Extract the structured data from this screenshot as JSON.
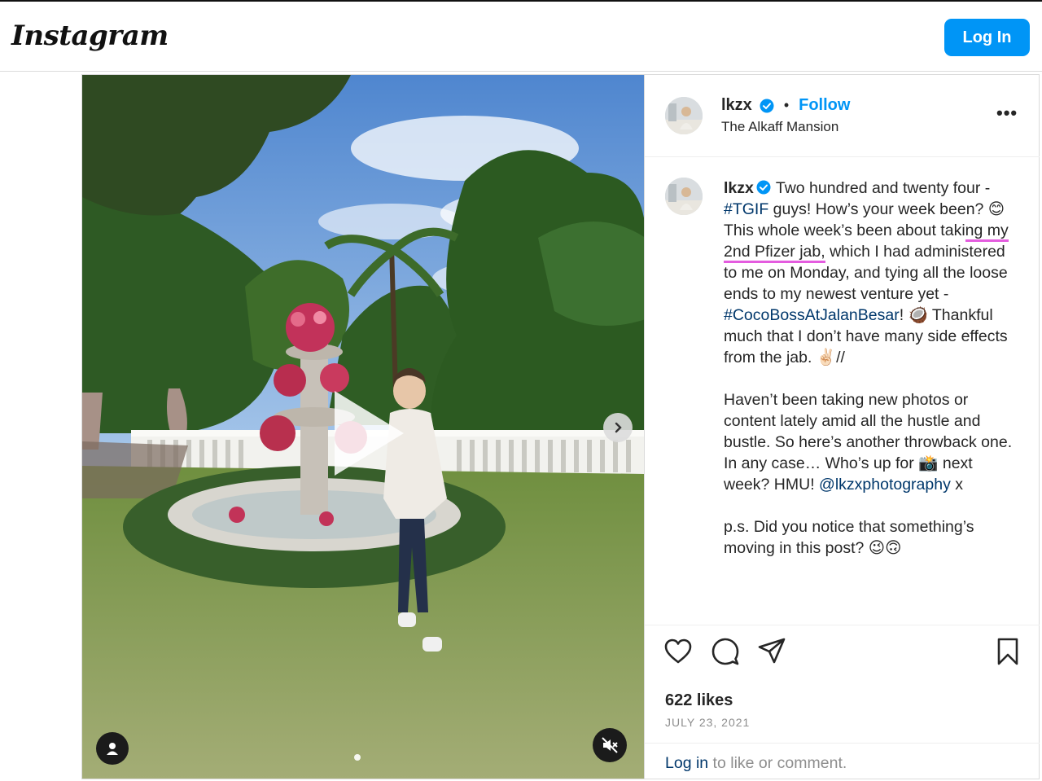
{
  "app": {
    "logo": "Instagram",
    "login_label": "Log In"
  },
  "post": {
    "username": "lkzx",
    "follow_label": "Follow",
    "location": "The Alkaff Mansion",
    "more_label": "•••",
    "caption": {
      "p1_a": "Two hundred and twenty four - ",
      "tag_tgif": "#TGIF",
      "p1_b": " guys! How’s your week been? 😊 This whole week’s been about taki",
      "p1_underlined": "ng my 2nd Pfizer jab,",
      "p1_c": " which I had administered to me on Monday, and tying all the loose ends to my newest venture yet - ",
      "tag_coco": "#CocoBossAtJalanBesar",
      "p1_d": "! 🥥 Thankful much that I don’t have many side effects from the jab. ✌🏻//",
      "p2_a": "Haven’t been taking new photos or content lately amid all the hustle and bustle. So here’s another throwback one. In any case… Who’s up for 📸 next week? HMU! ",
      "mention": "@lkzxphotography",
      "p2_b": " x",
      "p3": "p.s. Did you notice that something’s moving in this post? 😉🙃"
    },
    "likes": "622 likes",
    "date": "JULY 23, 2021",
    "comment_login": "Log in",
    "comment_rest": " to like or comment."
  },
  "icons": {
    "like": "heart-icon",
    "comment": "comment-icon",
    "share": "share-icon",
    "save": "bookmark-icon",
    "play": "play-icon",
    "next": "chevron-right-icon",
    "tag": "user-tag-icon",
    "mute": "muted-speaker-icon",
    "verified": "verified-badge-icon"
  },
  "colors": {
    "accent": "#0095f6",
    "link": "#00376b",
    "underline_mark": "#e45cdf"
  }
}
